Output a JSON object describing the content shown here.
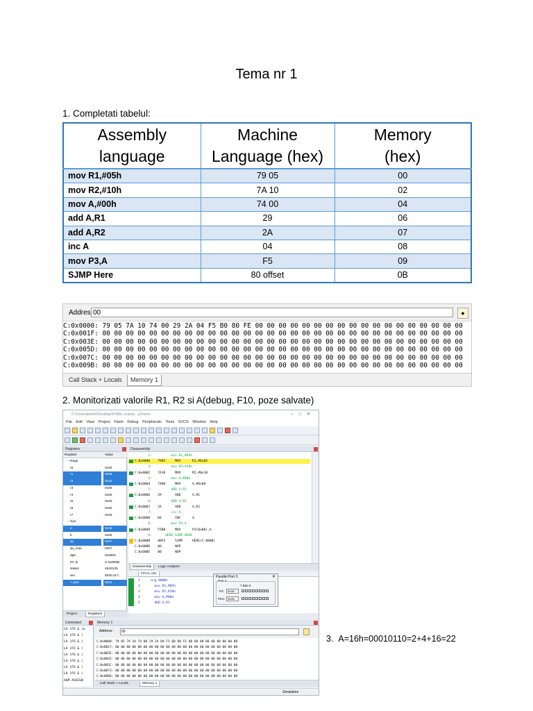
{
  "doc": {
    "title": "Tema nr 1",
    "section1": "1. Completati tabelul:",
    "section2": "2. Monitorizati valorile R1, R2 si A(debug, F10, poze salvate)",
    "section3": "3.  A=16h=00010110=2+4+16=22"
  },
  "table": {
    "headers": [
      [
        "Assembly",
        "language"
      ],
      [
        "Machine",
        "Language (hex)"
      ],
      [
        "Memory",
        "(hex)"
      ]
    ],
    "rows": [
      {
        "asm": "mov R1,#05h",
        "hex": "79 05",
        "mem": "00"
      },
      {
        "asm": "mov R2,#10h",
        "hex": "7A 10",
        "mem": "02"
      },
      {
        "asm": "mov A,#00h",
        "hex": "74 00",
        "mem": "04"
      },
      {
        "asm": "add A,R1",
        "hex": "29",
        "mem": "06"
      },
      {
        "asm": "add A,R2",
        "hex": "2A",
        "mem": "07"
      },
      {
        "asm": "inc A",
        "hex": "04",
        "mem": "08"
      },
      {
        "asm": "mov P3,A",
        "hex": "F5",
        "mem": "09"
      },
      {
        "asm": "SJMP Here",
        "hex": "80 offset",
        "mem": "0B"
      }
    ]
  },
  "memory1": {
    "address_label": "Address:",
    "address_value": "00",
    "lines": [
      "C:0x0000: 79 05 7A 10 74 00 29 2A 04 F5 B0 80 FE 00 00 00 00 00 00 00 00 00 00 00 00 00 00 00 00 00 00",
      "C:0x001F: 00 00 00 00 00 00 00 00 00 00 00 00 00 00 00 00 00 00 00 00 00 00 00 00 00 00 00 00 00 00 00",
      "C:0x003E: 00 00 00 00 00 00 00 00 00 00 00 00 00 00 00 00 00 00 00 00 00 00 00 00 00 00 00 00 00 00 00",
      "C:0x005D: 00 00 00 00 00 00 00 00 00 00 00 00 00 00 00 00 00 00 00 00 00 00 00 00 00 00 00 00 00 00 00",
      "C:0x007C: 00 00 00 00 00 00 00 00 00 00 00 00 00 00 00 00 00 00 00 00 00 00 00 00 00 00 00 00 00 00 00",
      "C:0x009B: 00 00 00 00 00 00 00 00 00 00 00 00 00 00 00 00 00 00 00 00 00 00 00 00 00 00 00 00 00 00 00"
    ],
    "tabs": [
      "Call Stack + Locals",
      "Memory 1"
    ]
  },
  "uvision": {
    "title": "C:\\Users\\peter\\Desktop\\FINAL.uvproj - µVision",
    "menu": "File  Edit  View  Project  Flash  Debug  Peripherals  Tools  SVCS  Window  Help",
    "registers": {
      "panel_title": "Registers",
      "col_register": "Register",
      "col_value": "Value",
      "rows": [
        {
          "n": "− Regs",
          "v": "",
          "grp": true
        },
        {
          "n": "r0",
          "v": "0x00"
        },
        {
          "n": "r1",
          "v": "0x05",
          "sel": true
        },
        {
          "n": "r2",
          "v": "0x10",
          "sel": true
        },
        {
          "n": "r3",
          "v": "0x00"
        },
        {
          "n": "r4",
          "v": "0x00"
        },
        {
          "n": "r5",
          "v": "0x00"
        },
        {
          "n": "r6",
          "v": "0x00"
        },
        {
          "n": "r7",
          "v": "0x00"
        },
        {
          "n": "− Sys",
          "v": "",
          "grp": true
        },
        {
          "n": "a",
          "v": "0x16",
          "sel": true
        },
        {
          "n": "b",
          "v": "0x00"
        },
        {
          "n": "sp",
          "v": "0x07",
          "sel": true
        },
        {
          "n": "sp_max",
          "v": "0x07"
        },
        {
          "n": "dptr",
          "v": "0x0000"
        },
        {
          "n": "PC $",
          "v": "C:0x000B"
        },
        {
          "n": "states",
          "v": "4643125"
        },
        {
          "n": "sec",
          "v": "5030.117..."
        },
        {
          "n": "+ psw",
          "v": "0x01",
          "sel": true
        }
      ],
      "tabs": [
        "Project",
        "Registers"
      ]
    },
    "disassembly": {
      "panel_title": "Disassembly",
      "lines": [
        {
          "t": "       2:          mov R1,#05h",
          "k": "src"
        },
        {
          "t": "C:0x0000    7905     MOV      R1,#0x05",
          "k": "hl"
        },
        {
          "t": "       3:          mov R2,#10h",
          "k": "src"
        },
        {
          "t": "C:0x0002    7A10     MOV      R2,#0x10",
          "k": "ins"
        },
        {
          "t": "       4:          mov A,#00h",
          "k": "src"
        },
        {
          "t": "C:0x0004    7400     MOV      A,#0x00",
          "k": "ins"
        },
        {
          "t": "       5:          ADD A,R1",
          "k": "src"
        },
        {
          "t": "C:0x0006    29       ADD      A,R1",
          "k": "ins"
        },
        {
          "t": "       6:          ADD A,R2",
          "k": "src"
        },
        {
          "t": "C:0x0007    2A       ADD      A,R2",
          "k": "ins"
        },
        {
          "t": "       7:          inc A",
          "k": "src"
        },
        {
          "t": "C:0x0008    04       INC      A",
          "k": "ins"
        },
        {
          "t": "       8:          mov P3,A",
          "k": "src"
        },
        {
          "t": "C:0x0009    F5B0     MOV      P3(0xB0),A",
          "k": "ins"
        },
        {
          "t": "       9:       HERE:SJMP HERE",
          "k": "src"
        },
        {
          "t": "C:0x000B    80FE     SJMP     HERE(C:000B)",
          "k": "cur"
        },
        {
          "t": "C:0x000D    00       NOP",
          "k": "plain"
        },
        {
          "t": "C:0x000E    00       NOP",
          "k": "plain"
        }
      ],
      "tabs": [
        "Disassembly",
        "Logic Analyzer"
      ]
    },
    "source": {
      "tab": "FINAL.a51",
      "lines": [
        {
          "n": "1",
          "t": "org 0000h"
        },
        {
          "n": "2",
          "t": "  mov R1,#05h"
        },
        {
          "n": "3",
          "t": "  mov R2,#10h"
        },
        {
          "n": "4",
          "t": "  mov A,#00h"
        },
        {
          "n": "5",
          "t": "  ADD A,R1"
        }
      ]
    },
    "parallel_port": {
      "title": "Parallel Port 3",
      "group": "Port 3",
      "p3_label": "P3:",
      "p3_value": "0x16",
      "pins_label": "Pins:",
      "pins_value": "0x16",
      "bits_label": "7      Bits      0"
    },
    "command": {
      "panel_title": "Command",
      "lines": [
        "LA (P3 & (a",
        "LA (P3 & (",
        "LA (P3 & (",
        "LA (P3 & (",
        "LA (P3 & (",
        "LA (P3 & (",
        "LA (P3 & (",
        "LA (P3 & (",
        "ASM ASSIGN"
      ]
    },
    "memory": {
      "panel_title": "Memory 1",
      "address_label": "Address:",
      "address_value": "00",
      "lines": [
        "C:0x0000: 79 05 7A 10 74 00 29 2A 04 F5 B0 80 FE 00 00 00 00 00 00 00 00 00",
        "C:0x0017: 00 00 00 00 00 00 00 00 00 00 00 00 00 00 00 00 00 00 00 00 00 00",
        "C:0x002E: 00 00 00 00 00 00 00 00 00 00 00 00 00 00 00 00 00 00 00 00 00 00",
        "C:0x0045: 00 00 00 00 00 00 00 00 00 00 00 00 00 00 00 00 00 00 00 00 00 00",
        "C:0x005C: 00 00 00 00 00 00 00 00 00 00 00 00 00 00 00 00 00 00 00 00 00 00",
        "C:0x0073: 00 00 00 00 00 00 00 00 00 00 00 00 00 00 00 00 00 00 00 00 00 00",
        "C:0x008A: 00 00 00 00 00 00 00 00 00 00 00 00 00 00 00 00 00 00 00 00 00 00"
      ],
      "tabs": [
        "Call Stack + Locals",
        "Memory 1"
      ]
    },
    "status": "Simulation"
  }
}
